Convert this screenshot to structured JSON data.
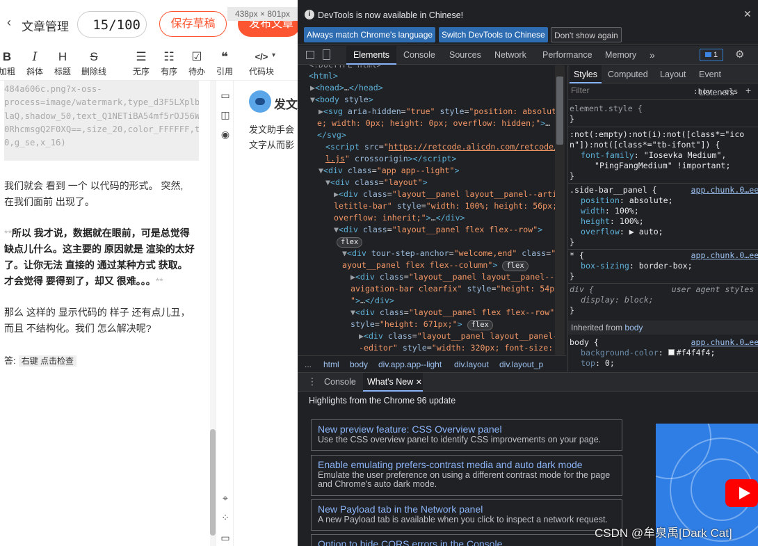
{
  "editor": {
    "back_label": "文章管理",
    "title_count": "15/100",
    "save_draft": "保存草稿",
    "publish": "发布文章",
    "size_tip": "438px × 801px",
    "toolbar": [
      {
        "icon": "B",
        "label": "加粗"
      },
      {
        "icon": "I",
        "label": "斜体"
      },
      {
        "icon": "H",
        "label": "标题"
      },
      {
        "icon": "S",
        "label": "删除线"
      },
      {
        "icon": "☰",
        "label": "无序"
      },
      {
        "icon": "☷",
        "label": "有序"
      },
      {
        "icon": "☑",
        "label": "待办"
      },
      {
        "icon": "❝",
        "label": "引用"
      },
      {
        "icon": "</>",
        "label": "代码块"
      }
    ],
    "code_lines": [
      "484a606c.png?x-oss-",
      "process=image/watermark,type_d3F5LXplbmh",
      "laQ,shadow_50,text_Q1NETiBA54mf5rOJ56W",
      "0RhcmsgQ2F0XQ==,size_20,color_FFFFFF,t_7",
      "0,g_se,x_16)"
    ],
    "para1": [
      "我们就会 看到 一个 以代码的形式。 突然,",
      "在我们面前 出现了。"
    ],
    "para2_prefix": "**",
    "para2": [
      "所以 我才说，数据就在眼前，可是总觉得",
      "缺点儿什么。这主要的 原因就是 渲染的太好",
      "了。让你无法 直接的 通过某种方式 获取。",
      "才会觉得 要得到了，却又 很难。。。"
    ],
    "para2_suffix": "**",
    "para3": [
      "那么 这样的 显示代码的 样子 还有点儿丑，",
      "而且 不结构化。我们 怎么解决呢?"
    ],
    "answer_label": "答:",
    "answer_value": "右键 点击检查"
  },
  "preview": {
    "title": "发文",
    "text": "发文助手会\n文字从而影"
  },
  "devtools": {
    "info_text": "DevTools is now available in Chinese!",
    "info_buttons": [
      "Always match Chrome's language",
      "Switch DevTools to Chinese",
      "Don't show again"
    ],
    "tabs": [
      "Elements",
      "Console",
      "Sources",
      "Network",
      "Performance",
      "Memory"
    ],
    "more_tabs": "»",
    "issues_count": "1",
    "crumbs": [
      "html",
      "body",
      "div.app.app--light",
      "div.layout",
      "div.layout_p"
    ],
    "crumbs_dots": "...",
    "style_tabs": [
      "Styles",
      "Computed",
      "Layout",
      "Event Listeners"
    ],
    "filter_placeholder": "Filter",
    "hov": ":hov",
    "cls": ".cls",
    "plus": "+",
    "inherited_label": "Inherited from",
    "inherited_from": "body",
    "drawer_tabs": [
      "Console",
      "What's New"
    ],
    "whatsnew_title": "Highlights from the Chrome 96 update",
    "cards": [
      {
        "title": "New preview feature: CSS Overview panel",
        "desc": "Use the CSS overview panel to identify CSS improvements on your page."
      },
      {
        "title": "Enable emulating prefers-contrast media and auto dark mode",
        "desc": "Emulate the user preference on using a different contrast mode for the page and Chrome's auto dark mode."
      },
      {
        "title": "New Payload tab in the Network panel",
        "desc": "A new Payload tab is available when you click to inspect a network request."
      },
      {
        "title": "Option to hide CORS errors in the Console",
        "desc": ""
      }
    ]
  },
  "watermark": "CSDN @牟泉禹[Dark Cat]"
}
